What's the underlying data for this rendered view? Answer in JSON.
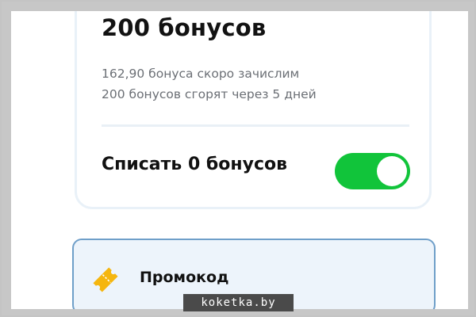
{
  "bonus_card": {
    "title": "200 бонусов",
    "pending_line": "162,90 бонуса скоро зачислим",
    "expiry_line": "200 бонусов сгорят через 5 дней",
    "spend_label": "Списать 0 бонусов",
    "spend_toggle_on": true
  },
  "promo_card": {
    "label": "Промокод",
    "icon": "ticket-icon"
  },
  "watermark": {
    "text": "koketka.by"
  },
  "colors": {
    "toggle_on": "#11c43a",
    "promo_background": "#edf4fb",
    "promo_border": "#6f9fc9",
    "ticket_icon": "#f5b60f"
  }
}
